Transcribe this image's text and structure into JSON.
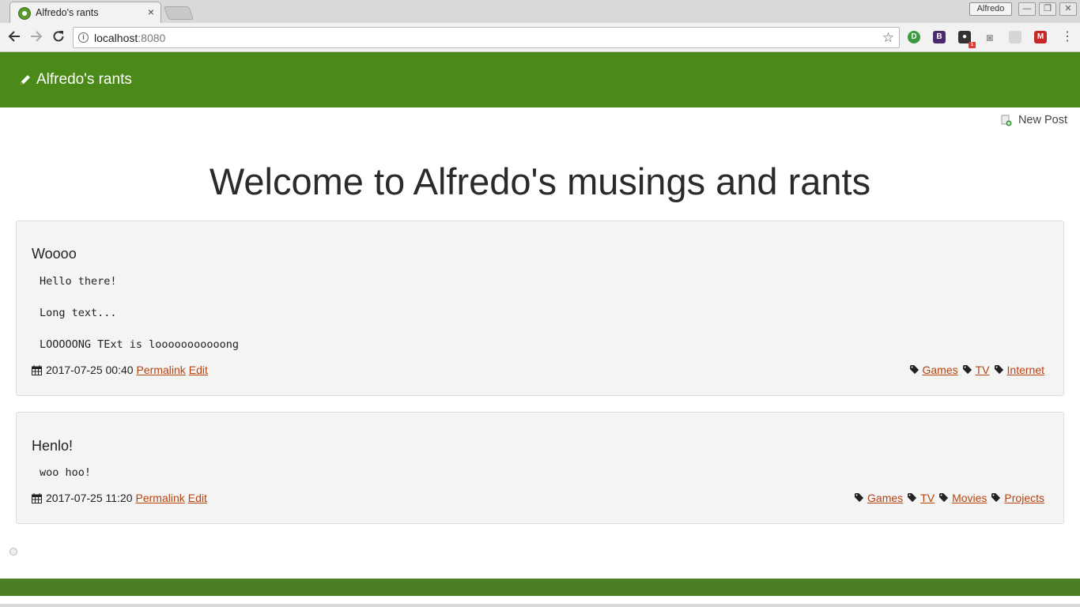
{
  "browser": {
    "tab_title": "Alfredo's rants",
    "tab_close": "×",
    "profile_name": "Alfredo",
    "url_host": "localhost",
    "url_port": ":8080",
    "window_minimize": "—",
    "window_restore": "❐",
    "window_close": "✕",
    "back_icon": "back-arrow-icon",
    "forward_icon": "forward-arrow-icon",
    "reload_icon": "reload-icon"
  },
  "site": {
    "brand": "Alfredo's rants",
    "new_post": "New Post",
    "headline": "Welcome to Alfredo's musings and rants",
    "accent_color": "#4b8a19",
    "link_color": "#b8420c"
  },
  "posts": [
    {
      "title": "Woooo",
      "lines": [
        "Hello there!",
        "Long text...",
        "LOOOOONG TExt is looooooooooong"
      ],
      "date": "2017-07-25 00:40",
      "permalink": "Permalink",
      "edit": "Edit",
      "tags": [
        "Games",
        "TV",
        "Internet"
      ]
    },
    {
      "title": "Henlo!",
      "lines": [
        "woo hoo!"
      ],
      "date": "2017-07-25 11:20",
      "permalink": "Permalink",
      "edit": "Edit",
      "tags": [
        "Games",
        "TV",
        "Movies",
        "Projects"
      ]
    }
  ]
}
